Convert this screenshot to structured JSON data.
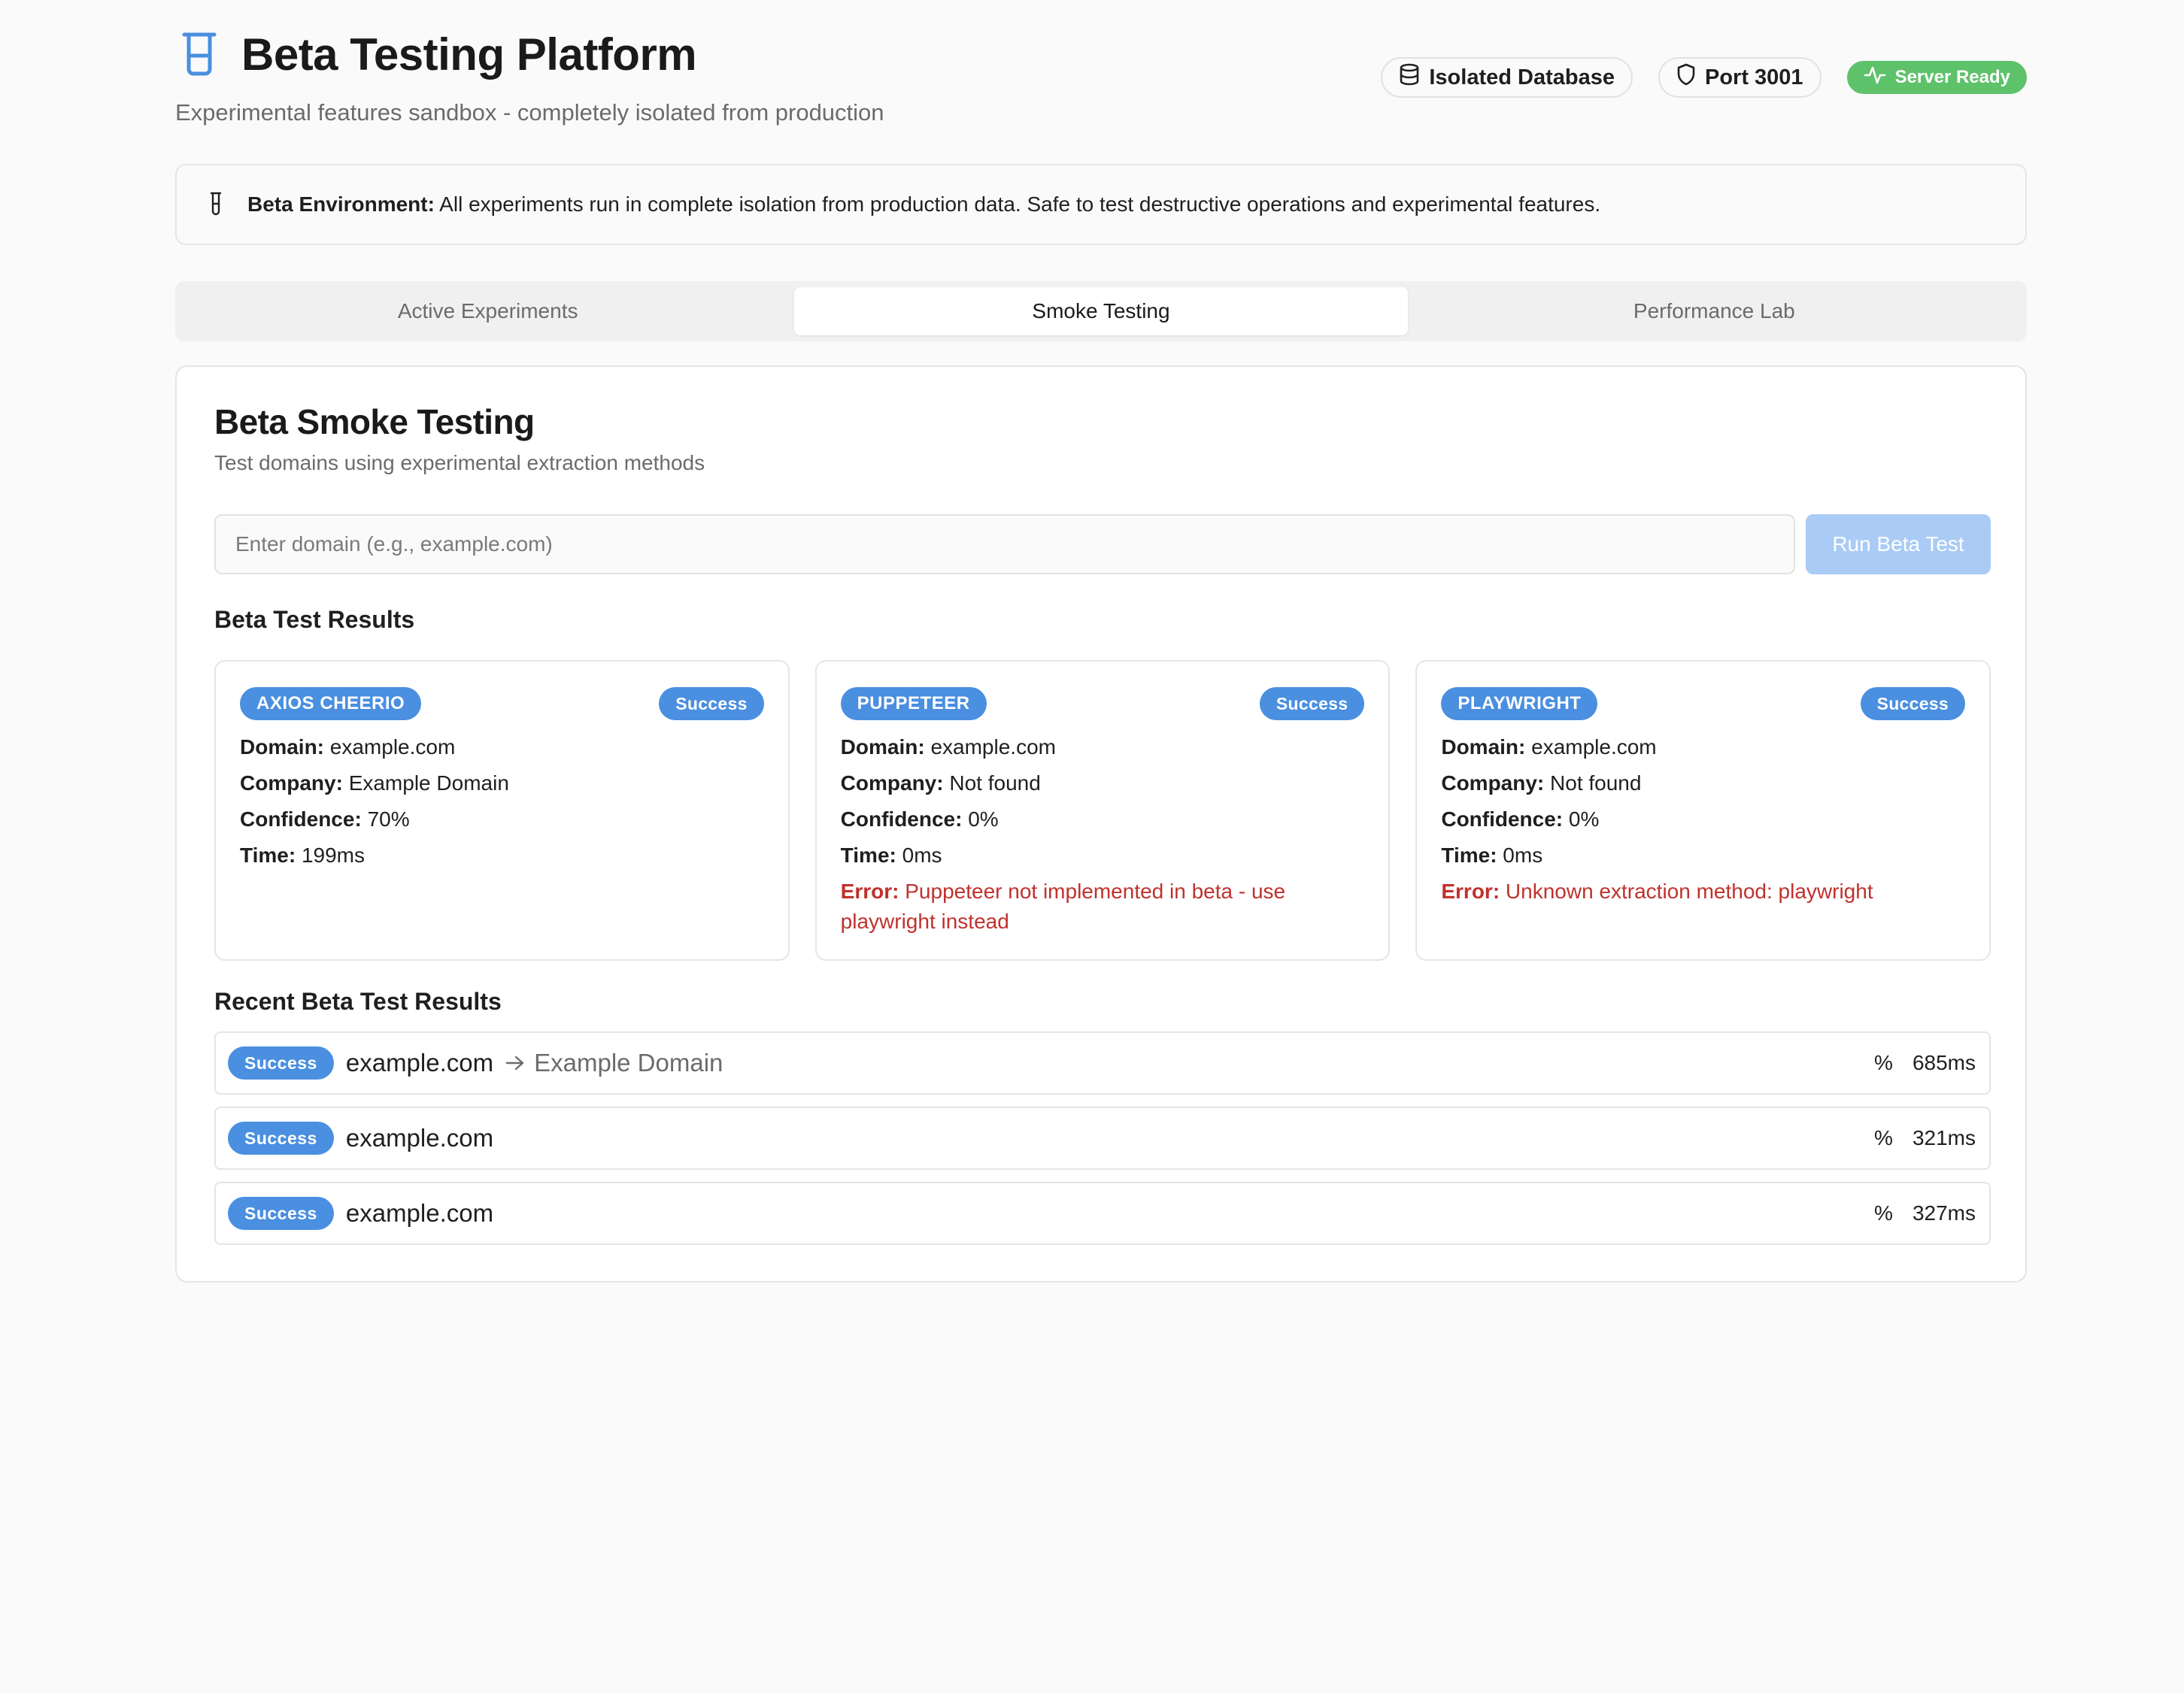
{
  "header": {
    "title": "Beta Testing Platform",
    "subtitle": "Experimental features sandbox - completely isolated from production",
    "badges": [
      {
        "label": "Isolated Database",
        "icon": "database-icon"
      },
      {
        "label": "Port 3001",
        "icon": "shield-icon"
      },
      {
        "label": "Server Ready",
        "icon": "activity-icon"
      }
    ]
  },
  "alert": {
    "label": "Beta Environment:",
    "text": "All experiments run in complete isolation from production data. Safe to test destructive operations and experimental features."
  },
  "tabs": [
    {
      "label": "Active Experiments",
      "active": false
    },
    {
      "label": "Smoke Testing",
      "active": true
    },
    {
      "label": "Performance Lab",
      "active": false
    }
  ],
  "smoke": {
    "title": "Beta Smoke Testing",
    "description": "Test domains using experimental extraction methods",
    "input": {
      "value": "",
      "placeholder": "Enter domain (e.g., example.com)"
    },
    "run_button": "Run Beta Test",
    "results_heading": "Beta Test Results",
    "field_labels": {
      "domain": "Domain:",
      "company": "Company:",
      "confidence": "Confidence:",
      "time": "Time:",
      "error": "Error:"
    },
    "results": [
      {
        "method": "AXIOS CHEERIO",
        "status": "Success",
        "domain": "example.com",
        "company": "Example Domain",
        "confidence": "70%",
        "time": "199ms",
        "error": ""
      },
      {
        "method": "PUPPETEER",
        "status": "Success",
        "domain": "example.com",
        "company": "Not found",
        "confidence": "0%",
        "time": "0ms",
        "error": "Puppeteer not implemented in beta - use playwright instead"
      },
      {
        "method": "PLAYWRIGHT",
        "status": "Success",
        "domain": "example.com",
        "company": "Not found",
        "confidence": "0%",
        "time": "0ms",
        "error": "Unknown extraction method: playwright"
      }
    ],
    "recent_heading": "Recent Beta Test Results",
    "recent": [
      {
        "status": "Success",
        "domain": "example.com",
        "company": "Example Domain",
        "percent": "%",
        "time": "685ms"
      },
      {
        "status": "Success",
        "domain": "example.com",
        "company": "",
        "percent": "%",
        "time": "321ms"
      },
      {
        "status": "Success",
        "domain": "example.com",
        "company": "",
        "percent": "%",
        "time": "327ms"
      }
    ]
  },
  "colors": {
    "accent": "#4a8fe0",
    "run_button_disabled": "#a9cbf5",
    "ready_green": "#5ec26a",
    "error_red": "#c0312d"
  }
}
